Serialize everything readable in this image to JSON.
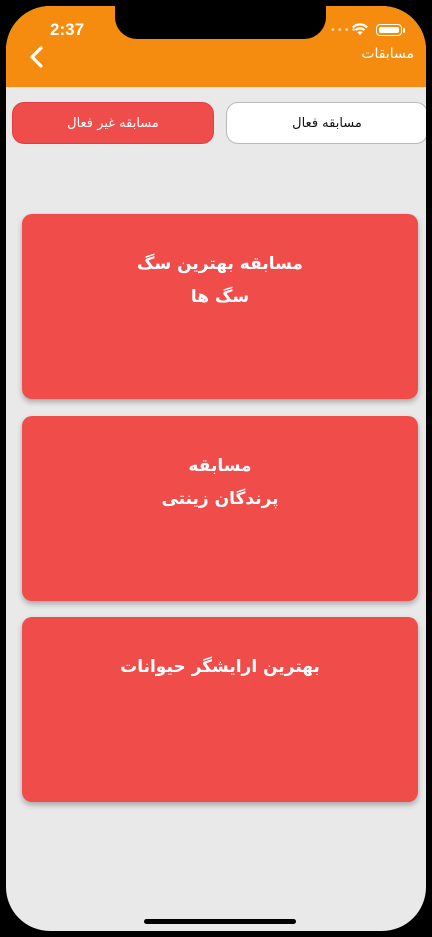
{
  "status_bar": {
    "time": "2:37",
    "signal_dots": "••••"
  },
  "header": {
    "title": "مسابقات",
    "back_icon": "chevron-left-icon",
    "background": "#f68c0f"
  },
  "tabs": {
    "active_competitions": "مسابقه فعال",
    "inactive_competitions": "مسابقه غیر فعال"
  },
  "cards": [
    {
      "line1": "مسابقه بهترین سگ",
      "line2": "سگ ها"
    },
    {
      "line1": "مسابقه",
      "line2": "پرندگان زینتی"
    },
    {
      "line1": "بهترین ارایشگر حیوانات",
      "line2": ""
    }
  ],
  "colors": {
    "card": "#ef4c4a",
    "inactive_tab": "#ef4c4c",
    "page_background": "#e9e9e9"
  }
}
